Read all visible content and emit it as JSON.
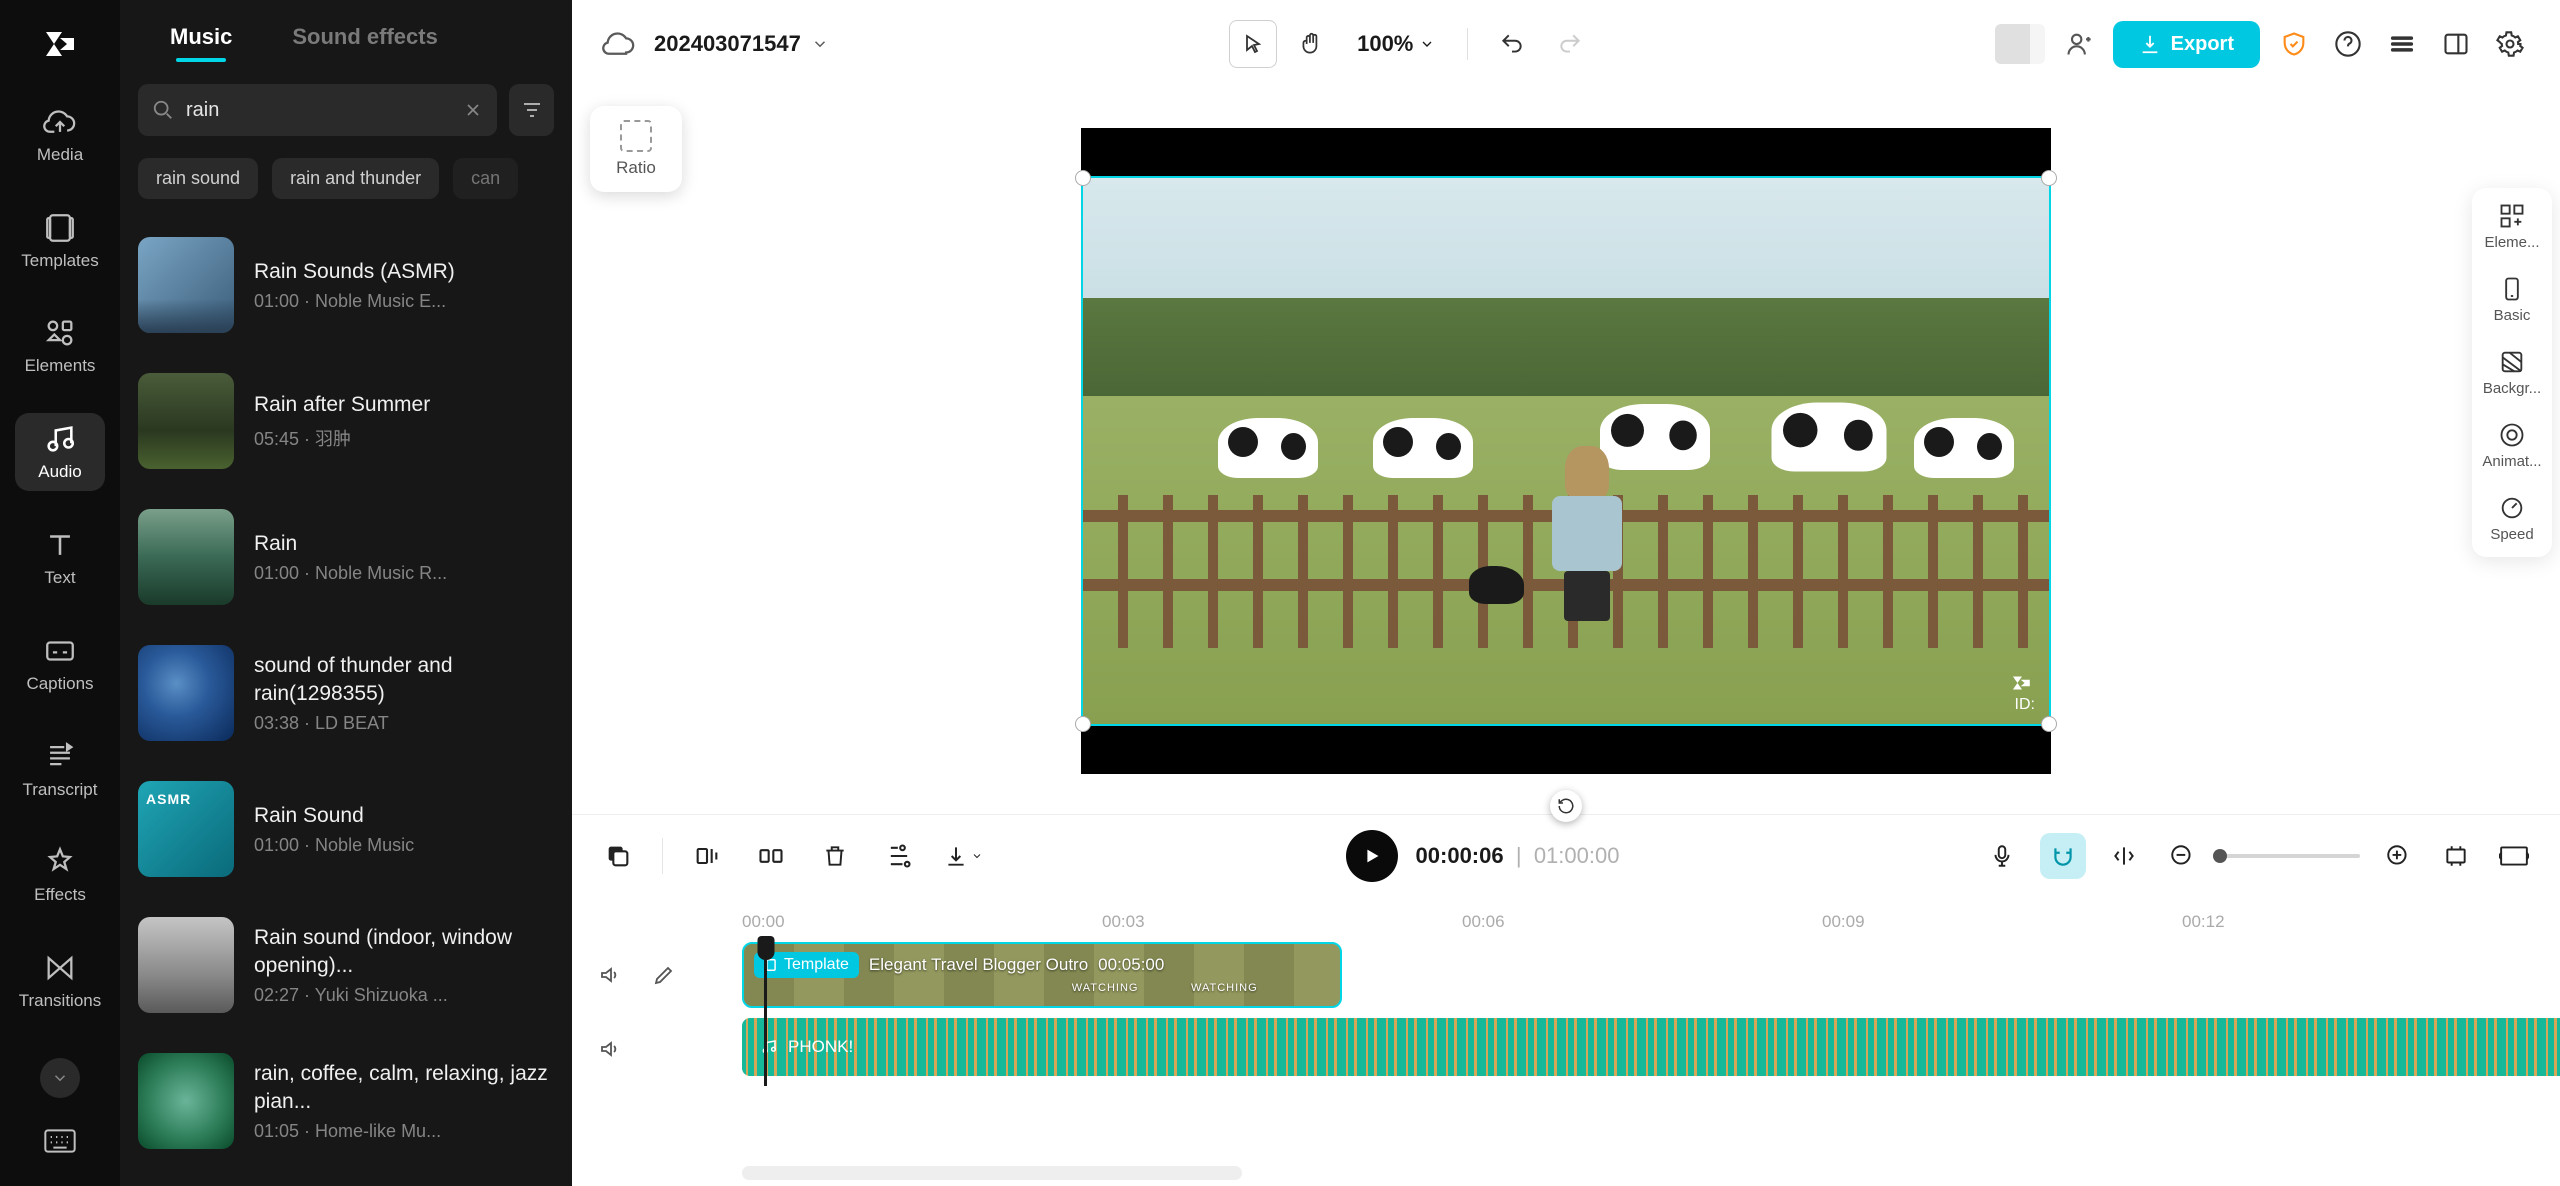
{
  "project_title": "202403071547",
  "zoom": "100%",
  "export_label": "Export",
  "ratio_label": "Ratio",
  "preview_id_label": "ID:",
  "left_nav": [
    {
      "id": "media",
      "label": "Media"
    },
    {
      "id": "templates",
      "label": "Templates"
    },
    {
      "id": "elements",
      "label": "Elements"
    },
    {
      "id": "audio",
      "label": "Audio"
    },
    {
      "id": "text",
      "label": "Text"
    },
    {
      "id": "captions",
      "label": "Captions"
    },
    {
      "id": "transcript",
      "label": "Transcript"
    },
    {
      "id": "effects",
      "label": "Effects"
    },
    {
      "id": "transitions",
      "label": "Transitions"
    }
  ],
  "panel_tabs": {
    "music": "Music",
    "sound_effects": "Sound effects"
  },
  "search": {
    "value": "rain"
  },
  "chips": [
    "rain sound",
    "rain and thunder",
    "can"
  ],
  "results": [
    {
      "title": "Rain Sounds (ASMR)",
      "duration": "01:00",
      "artist": "Noble Music E..."
    },
    {
      "title": "Rain after Summer",
      "duration": "05:45",
      "artist": "羽肿"
    },
    {
      "title": "Rain",
      "duration": "01:00",
      "artist": "Noble Music R..."
    },
    {
      "title": "sound of thunder and rain(1298355)",
      "duration": "03:38",
      "artist": "LD BEAT"
    },
    {
      "title": "Rain Sound",
      "duration": "01:00",
      "artist": "Noble Music"
    },
    {
      "title": "Rain sound (indoor, window opening)...",
      "duration": "02:27",
      "artist": "Yuki Shizuoka ..."
    },
    {
      "title": "rain, coffee, calm, relaxing, jazz pian...",
      "duration": "01:05",
      "artist": "Home-like Mu..."
    }
  ],
  "right_panel": [
    {
      "id": "elements",
      "label": "Eleme..."
    },
    {
      "id": "basic",
      "label": "Basic"
    },
    {
      "id": "background",
      "label": "Backgr..."
    },
    {
      "id": "animation",
      "label": "Animat..."
    },
    {
      "id": "speed",
      "label": "Speed"
    }
  ],
  "timecode": {
    "current": "00:00:06",
    "duration": "01:00:00",
    "separator": "|"
  },
  "ruler_ticks": [
    {
      "label": "00:00",
      "pos": 0
    },
    {
      "label": "00:03",
      "pos": 360
    },
    {
      "label": "00:06",
      "pos": 720
    },
    {
      "label": "00:09",
      "pos": 1080
    },
    {
      "label": "00:12",
      "pos": 1440
    }
  ],
  "video_clip": {
    "badge": "Template",
    "title": "Elegant Travel Blogger Outro",
    "duration": "00:05:00",
    "watching": "WATCHING"
  },
  "audio_clip": {
    "title": "PHONK!"
  }
}
